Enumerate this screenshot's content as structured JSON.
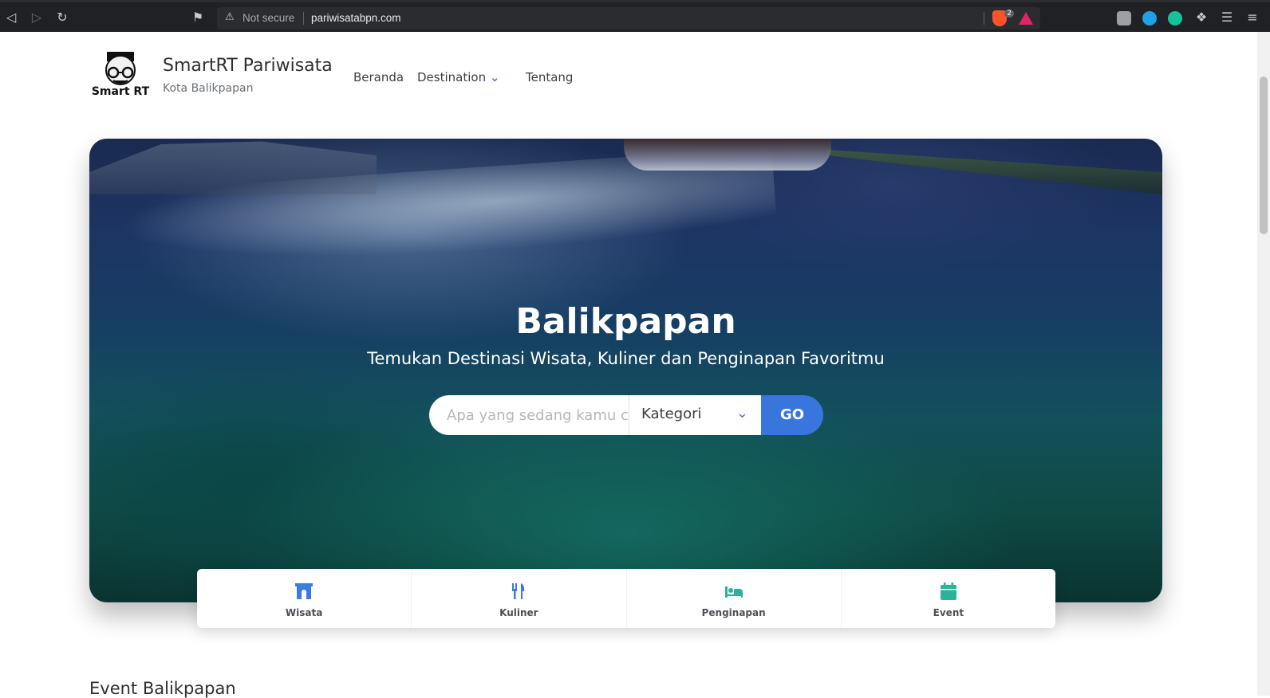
{
  "browser": {
    "security_label": "Not secure",
    "url": "pariwisatabpn.com",
    "brave_count": "2"
  },
  "site": {
    "logo_text": "Smart RT",
    "title": "SmartRT Pariwisata",
    "subtitle": "Kota Balikpapan"
  },
  "nav": {
    "items": [
      {
        "label": "Beranda"
      },
      {
        "label": "Destination"
      },
      {
        "label": "Tentang"
      }
    ]
  },
  "hero": {
    "title": "Balikpapan",
    "subtitle": "Temukan Destinasi Wisata, Kuliner dan Penginapan Favoritmu"
  },
  "search": {
    "placeholder": "Apa yang sedang kamu cari?",
    "category_selected": "Kategori",
    "go_label": "GO"
  },
  "categories": [
    {
      "label": "Wisata",
      "icon": "archway-icon",
      "color": "#3c79e0"
    },
    {
      "label": "Kuliner",
      "icon": "utensils-icon",
      "color": "#3c79e0"
    },
    {
      "label": "Penginapan",
      "icon": "bed-icon",
      "color": "#2bb39a"
    },
    {
      "label": "Event",
      "icon": "calendar-icon",
      "color": "#2bb39a"
    }
  ],
  "sections": {
    "event_title": "Event Balikpapan"
  },
  "colors": {
    "accent": "#3876dd",
    "teal": "#2bb39a"
  }
}
